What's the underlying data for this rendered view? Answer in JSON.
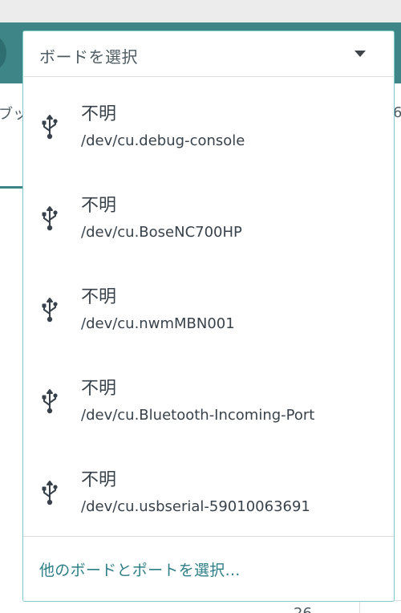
{
  "background": {
    "left_text": "ブッ",
    "right_text": "6",
    "bottom_text": "26"
  },
  "select": {
    "label": "ボードを選択"
  },
  "ports": [
    {
      "name": "不明",
      "path": "/dev/cu.debug-console"
    },
    {
      "name": "不明",
      "path": "/dev/cu.BoseNC700HP"
    },
    {
      "name": "不明",
      "path": "/dev/cu.nwmMBN001"
    },
    {
      "name": "不明",
      "path": "/dev/cu.Bluetooth-Incoming-Port"
    },
    {
      "name": "不明",
      "path": "/dev/cu.usbserial-59010063691"
    }
  ],
  "other_link": "他のボードとポートを選択...",
  "icons": {
    "port": "usb-icon",
    "caret": "caret-down-icon"
  },
  "colors": {
    "header": "#3e8587",
    "accent": "#7fcbcd",
    "link": "#2f7f87"
  }
}
